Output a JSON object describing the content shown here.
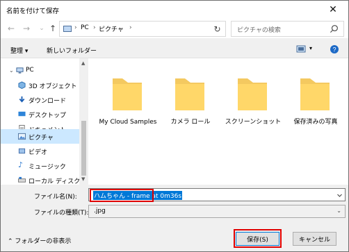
{
  "window": {
    "title": "名前を付けて保存",
    "close_symbol": "✕"
  },
  "nav": {
    "back_symbol": "←",
    "forward_symbol": "→",
    "up_symbol": "↑",
    "refresh_symbol": "↻",
    "breadcrumb": [
      "PC",
      "ピクチャ"
    ],
    "search_placeholder": "ピクチャの検索"
  },
  "toolbar": {
    "organize": "整理",
    "new_folder": "新しいフォルダー"
  },
  "sidebar": {
    "items": [
      {
        "label": "PC",
        "icon": "pc-icon"
      },
      {
        "label": "3D オブジェクト",
        "icon": "cube-icon"
      },
      {
        "label": "ダウンロード",
        "icon": "download-icon"
      },
      {
        "label": "デスクトップ",
        "icon": "desktop-icon"
      },
      {
        "label": "ドキュメント",
        "icon": "document-icon"
      },
      {
        "label": "ピクチャ",
        "icon": "picture-icon",
        "selected": true
      },
      {
        "label": "ビデオ",
        "icon": "video-icon"
      },
      {
        "label": "ミュージック",
        "icon": "music-icon"
      },
      {
        "label": "ローカル ディスク (C",
        "icon": "disk-icon"
      }
    ]
  },
  "folders": [
    {
      "label": "My Cloud Samples"
    },
    {
      "label": "カメラ ロール"
    },
    {
      "label": "スクリーンショット"
    },
    {
      "label": "保存済みの写真"
    }
  ],
  "fields": {
    "filename_label": "ファイル名(N):",
    "filename_value": "ハムちゃん - frame at 0m36s",
    "filetype_label": "ファイルの種類(T):",
    "filetype_value": ".jpg"
  },
  "footer": {
    "hide_folders": "フォルダーの非表示",
    "save": "保存(S)",
    "cancel": "キャンセル"
  },
  "colors": {
    "accent": "#0078d7",
    "highlight_red": "#e00000",
    "folder_yellow": "#ffd769",
    "selected_bg": "#cce8ff"
  }
}
